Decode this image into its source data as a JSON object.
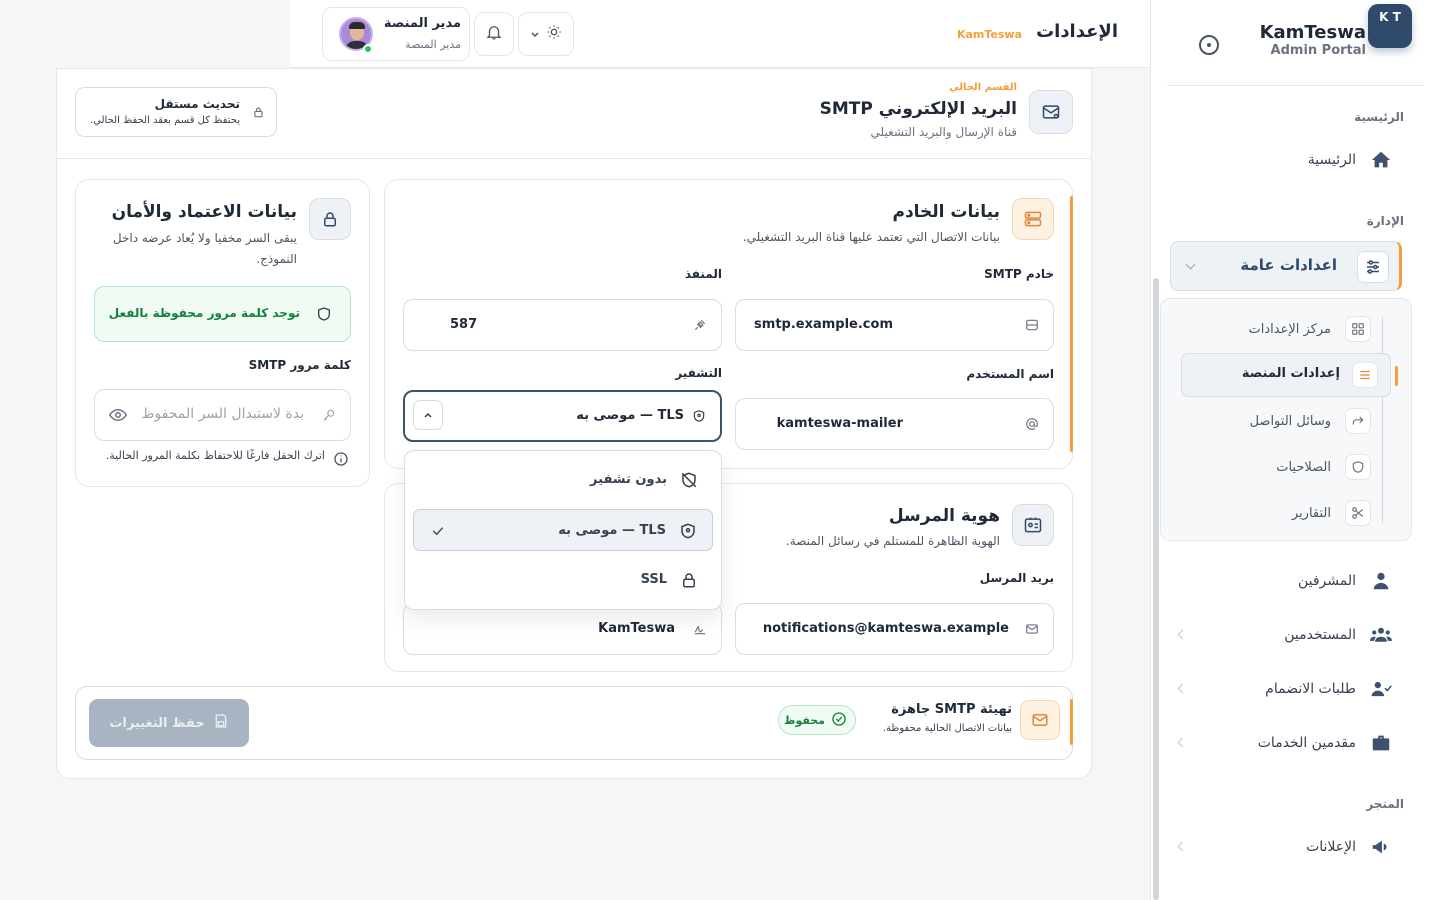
{
  "sidebar": {
    "logo_text": "K T",
    "brand_name": "KamTeswa",
    "brand_sub": "Admin Portal",
    "section_home": "الرئيسية",
    "home_item": "الرئيسية",
    "section_admin": "الإدارة",
    "general_settings": "اعدادات عامة",
    "sub_items": [
      "مركز الإعدادات",
      "إعدادات المنصة",
      "وسائل التواصل",
      "الصلاحيات",
      "التقارير"
    ],
    "supervisors": "المشرفين",
    "users": "المستخدمين",
    "join_requests": "طلبات الانضمام",
    "providers": "مقدمين الخدمات",
    "section_store": "المتجر",
    "ads": "الإعلانات"
  },
  "topbar": {
    "title": "الإعدادات",
    "brand": "KamTeswa",
    "user_name": "مدير المنصة",
    "user_role": "مدير المنصة"
  },
  "section": {
    "kicker": "القسم الحالي",
    "title": "البريد الإلكتروني SMTP",
    "subtitle": "قناة الإرسال والبريد التشغيلي",
    "indep_title": "تحديث مستقل",
    "indep_sub": "يحتفظ كل قسم بعقد الحفظ الحالي."
  },
  "server": {
    "title": "بيانات الخادم",
    "subtitle": "بيانات الاتصال التي تعتمد عليها قناة البريد التشغيلي.",
    "host_label": "خادم SMTP",
    "host_value": "smtp.example.com",
    "port_label": "المنفذ",
    "port_value": "587",
    "username_label": "اسم المستخدم",
    "username_value": "kamteswa-mailer",
    "encryption_label": "التشفير",
    "encryption_value": "TLS — موصى به",
    "options": [
      "بدون تشفير",
      "TLS — موصى به",
      "SSL"
    ]
  },
  "sender": {
    "title": "هوية المرسل",
    "subtitle": "الهوية الظاهرة للمستلم في رسائل المنصة.",
    "email_label": "بريد المرسل",
    "email_value": "notifications@kamteswa.example",
    "name_value": "KamTeswa"
  },
  "credentials": {
    "title": "بيانات الاعتماد والأمان",
    "subtitle": "يبقى السر مخفيا ولا يُعاد عرضه داخل النموذج.",
    "saved_notice": "توجد كلمة مرور محفوظة بالفعل",
    "password_label": "كلمة مرور SMTP",
    "password_placeholder": "بدة لاستبدال السر المحفوظ",
    "hint": "اترك الحقل فارغًا للاحتفاظ بكلمة المرور الحالية."
  },
  "savebar": {
    "title": "تهيئة SMTP جاهزة",
    "subtitle": "بيانات الاتصال الحالية محفوظة.",
    "badge": "محفوظ",
    "save_button": "حفظ التغييرات"
  },
  "colors": {
    "accent": "#f59e3b",
    "primary": "#2f4a6b",
    "success": "#15803d"
  }
}
